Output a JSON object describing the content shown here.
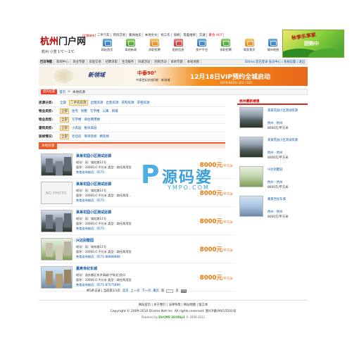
{
  "header": {
    "logo_city": "杭州",
    "logo_portal": "门户网",
    "switch_city": "[切换城市]",
    "weather": "杭州  小雪  1℃~-1℃",
    "top_links": [
      "二手汽车",
      "新房交易",
      "集体拍卖",
      "本地文文",
      "找工作",
      "保姆",
      "电脑维修",
      "交通",
      "聚会 HOT"
    ],
    "icon_nav": [
      "网站首页",
      "本地新闻",
      "求职招聘",
      "租房信息",
      "房产平台",
      "求职招聘",
      "商家黄页",
      "城市地图"
    ],
    "ad_text_1": "秋季乐享家",
    "ad_text_2": "团购中"
  },
  "catbar": {
    "head": "巴日导航",
    "items": [
      "新闻中心",
      "商业专题",
      "房屋交易",
      "招聘求职",
      "生活服务",
      "同城活动",
      "团购活动",
      "本地专题",
      "本地地图"
    ],
    "right": "Ditims 您已登录 会员中心 | 系统设置 | 退出"
  },
  "banner": {
    "brand": "新领域",
    "brand2": "中泰90°",
    "sub": "中泰世纪花城5期 · 新领域",
    "headline": "12月18日VIP预约全城启动",
    "phone": "0579-84221 222 / 333"
  },
  "breadcrumb": {
    "tag": "您的位置",
    "home": "首页",
    "sep": ">",
    "current": "本地房源"
  },
  "filters": [
    {
      "label": "房源分类:",
      "values": [
        "全部",
        "二手房房源",
        "出租房源",
        "出售房源",
        "求购房源",
        "求租房源"
      ],
      "selected": 1
    },
    {
      "label": "物业类型:",
      "values": [
        "全部",
        "住宅",
        "别墅",
        "写字楼",
        "公寓",
        "商铺"
      ],
      "selected": 0
    },
    {
      "label": "物业类型:",
      "values": [
        "全部",
        "写字楼",
        "商住两用楼"
      ],
      "selected": 0
    },
    {
      "label": "建筑类型:",
      "values": [
        "全部",
        "小高层",
        "板块高层"
      ],
      "selected": 0
    },
    {
      "label": "装修情况:",
      "values": [
        "全部",
        "毛坯房",
        "简单装修",
        "精装修"
      ],
      "selected": 0
    }
  ],
  "list_head": "本地房源",
  "listings": [
    {
      "title": "某某花园小区测试房源",
      "line1": "地址：如：城北路11号",
      "line2": "面积：10000.0 平方米  类型：商住两用型",
      "line3": "售楼咨询电话：0571-",
      "price": "8000元",
      "unit": "/平方米",
      "thumb": "photo"
    },
    {
      "title": "某某花园小区测试房源",
      "line1": "地址：如：城北路11号",
      "line2": "面积：10000.0 平方米  类型：商住两用...",
      "line3": "售楼咨询电话：0571-",
      "price": "8000元",
      "unit": "/平方米",
      "thumb": "nophoto"
    },
    {
      "title": "某某花园小区测试房源",
      "line1": "地址：如：城北路11号",
      "line2": "面积：10000.0 平方米  类型：商住两用型",
      "line3": "售楼咨询电话：0571-",
      "price": "8000元",
      "unit": "/平方米",
      "thumb": "photo"
    },
    {
      "title": "兴达别墅园",
      "line1": "地址：如：城东路11号",
      "line2": "面积：10000.0 平方米  类型：商住两用型",
      "line3": "售楼咨询电话：0571-88888888",
      "price": "8000元",
      "unit": "/平方米",
      "thumb": "green"
    },
    {
      "title": "嘉奥世纪东城",
      "line1": "地址：浙东都区东洪高级(宁陆北)交口",
      "line2": "面积：10000.0 平方米  类型：商住两用型",
      "line3": "售楼咨询电话：0571-87575999",
      "price": "8000元",
      "unit": "/平方米",
      "thumb": "city"
    }
  ],
  "no_photo": "NO PHOTO",
  "pager": {
    "summary": "共5条记录 | 当前第1/1页",
    "first": "首页",
    "prev": "上一页",
    "next": "下一页",
    "last": "尾页",
    "jump": "第",
    "jump_unit": "页",
    "go": "GO"
  },
  "sidebar": {
    "title": "杭州最新楼盘",
    "items": [
      {
        "name": "某某花园小区测试房源",
        "loc": "杭州 - 杭州",
        "price": "8000元/平方米",
        "thumb": "photo"
      },
      {
        "name": "某某花园小区测试房源",
        "loc": "杭州 - 杭州",
        "price": "8000元/平方米",
        "thumb": "photo"
      },
      {
        "name": "兴达别墅园",
        "loc": "杭州 - 杭州",
        "price": "8000元/平方米",
        "thumb": "green"
      },
      {
        "name": "嘉奥世纪东城",
        "loc": "杭州 - 杭州",
        "price": "8000元/平方米",
        "thumb": "city"
      }
    ]
  },
  "footer": {
    "links": "网站首页 | 关于我们 | 法律条款 | 网站地图 | 留言本",
    "copyright": "Copyright © 2009-2010 Dirzms.Net Inc. All rights reserved. 浙ICP备09015501号",
    "powered_prefix": "Powered by",
    "powered_name": "DirCMS 2010Sp1",
    "powered_suffix": "© 2009-2011"
  },
  "watermark": {
    "mark": "P",
    "cn": "源码婆",
    "en": "YMPO.COM"
  }
}
